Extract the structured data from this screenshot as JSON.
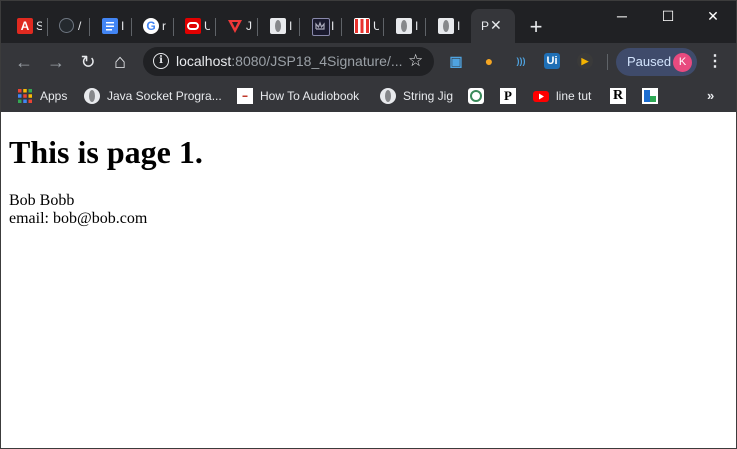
{
  "tabs": [
    {
      "title_initial": "S",
      "icon": "acrobat-icon",
      "color": "#e02a20"
    },
    {
      "title_initial": "/",
      "icon": "github-icon",
      "color": "#24292e"
    },
    {
      "title_initial": "I",
      "icon": "google-docs-icon",
      "color": "#4285f4"
    },
    {
      "title_initial": "r",
      "icon": "google-icon",
      "color": "#ffffff"
    },
    {
      "title_initial": "U",
      "icon": "oracle-icon",
      "color": "#e20000"
    },
    {
      "title_initial": "J",
      "icon": "vivaldi-icon",
      "color": "#ef3939"
    },
    {
      "title_initial": "I",
      "icon": "globe-icon",
      "color": "#e8eaed"
    },
    {
      "title_initial": "I",
      "icon": "crown-icon",
      "color": "#1a1a2e"
    },
    {
      "title_initial": "U",
      "icon": "stripes-icon",
      "color": "#e8322d"
    },
    {
      "title_initial": "I",
      "icon": "globe-icon",
      "color": "#e8eaed"
    },
    {
      "title_initial": "I",
      "icon": "globe-icon",
      "color": "#e8eaed"
    }
  ],
  "active_tab": {
    "title_initial": "P",
    "close": "✕"
  },
  "new_tab_label": "+",
  "window_controls": {
    "minimize": "─",
    "maximize": "☐",
    "close": "✕"
  },
  "toolbar": {
    "back": "←",
    "forward": "→",
    "reload": "↻",
    "home": "⌂",
    "url_host": "localhost",
    "url_path": ":8080/JSP18_4Signature/...",
    "star": "☆",
    "profile_label": "Paused",
    "profile_initial": "K",
    "menu": "⋮"
  },
  "extensions": [
    {
      "icon": "screen-capture-icon",
      "glyph": "▣",
      "color": "#4fa3e0"
    },
    {
      "icon": "bulb-icon",
      "glyph": "●",
      "color": "#f5a623"
    },
    {
      "icon": "wireless-icon",
      "glyph": ")))",
      "color": "#4fa3e0"
    },
    {
      "icon": "ui-icon",
      "glyph": "Ui",
      "color": "#ffffff"
    },
    {
      "icon": "play-icon",
      "glyph": "▶",
      "color": "#f5b400"
    }
  ],
  "bookmarks": [
    {
      "label": "Apps",
      "icon": "apps-grid-icon"
    },
    {
      "label": "Java Socket Progra...",
      "icon": "globe-icon"
    },
    {
      "label": "How To Audiobook",
      "icon": "audiobook-icon"
    },
    {
      "label": "String Jig",
      "icon": "globe-icon"
    },
    {
      "label": "",
      "icon": "circle-logo-icon"
    },
    {
      "label": "",
      "icon": "p-logo-icon"
    },
    {
      "label": "line tut",
      "icon": "youtube-icon"
    },
    {
      "label": "",
      "icon": "r-logo-icon"
    },
    {
      "label": "",
      "icon": "flag-logo-icon"
    }
  ],
  "bookmarks_more": "»",
  "page": {
    "heading": "This is page 1.",
    "name": "Bob Bobb",
    "email": "email: bob@bob.com"
  }
}
